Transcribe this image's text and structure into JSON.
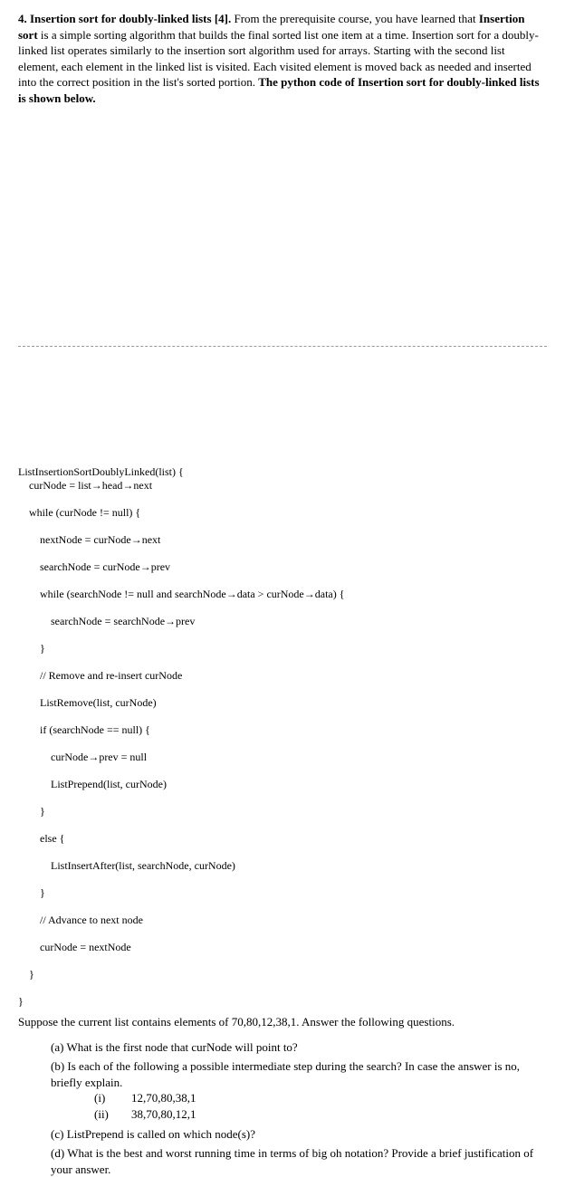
{
  "intro": {
    "heading": "4. Insertion sort for doubly-linked lists [4].",
    "text1": " From the prerequisite course, you have learned that ",
    "bold1": "Insertion sort",
    "text2": " is a simple sorting algorithm that builds the final sorted list one item at a time.  Insertion sort for a doubly-linked list operates similarly to the insertion sort algorithm used for arrays. Starting with the second list element, each element in the linked list is visited. Each visited element is moved back as needed and inserted into the correct position in the list's sorted portion. ",
    "bold2": "The python code of Insertion sort for doubly-linked lists is shown below."
  },
  "code": {
    "l1": "ListInsertionSortDoublyLinked(list) {",
    "l2": "curNode = list→head→next",
    "l3": "while (curNode != null) {",
    "l4": "nextNode = curNode→next",
    "l5": "searchNode = curNode→prev",
    "l6": "while (searchNode != null and searchNode→data > curNode→data) {",
    "l7": "searchNode = searchNode→prev",
    "l8": "}",
    "l9": "// Remove and re-insert curNode",
    "l10": "ListRemove(list, curNode)",
    "l11": "if (searchNode == null) {",
    "l12": "curNode→prev = null",
    "l13": "ListPrepend(list, curNode)",
    "l14": "}",
    "l15": "else {",
    "l16": "ListInsertAfter(list, searchNode, curNode)",
    "l17": "}",
    "l18": "// Advance to next node",
    "l19": "curNode = nextNode",
    "l20": "}",
    "l21": "}"
  },
  "suppose": "Suppose the current list contains elements of 70,80,12,38,1. Answer the following questions.",
  "qa": {
    "a_label": "(a)",
    "a_text": "What is the first node that curNode will point to?",
    "b_label": "(b)",
    "b_text": "Is each of the following a possible intermediate step during the search? In case the answer is no, briefly explain.",
    "b_i_label": "(i)",
    "b_i_text": "12,70,80,38,1",
    "b_ii_label": "(ii)",
    "b_ii_text": "38,70,80,12,1",
    "c_label": "(c)",
    "c_text": "ListPrepend is called on which node(s)?",
    "d_label": "(d)",
    "d_text": "What is the best and worst running time in terms of big oh notation? Provide a brief justification of your answer."
  }
}
